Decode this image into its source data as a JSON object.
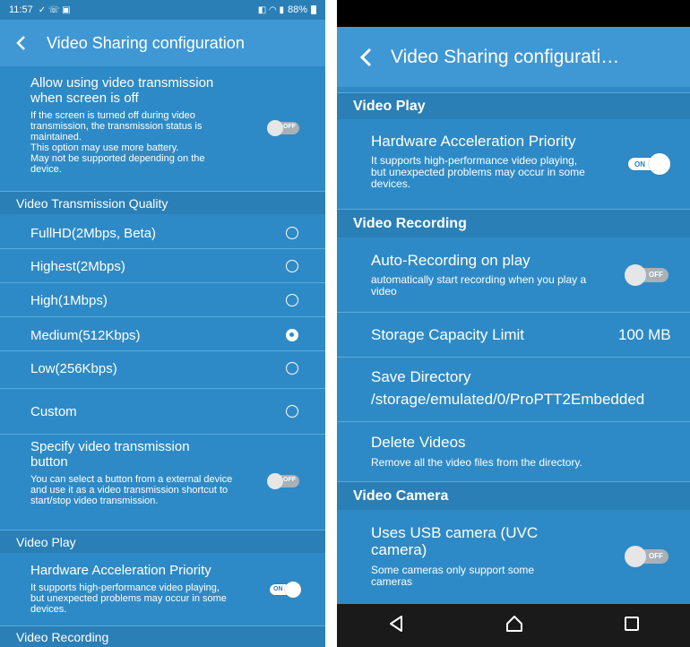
{
  "left": {
    "status": {
      "time": "11:57",
      "battery": "88%"
    },
    "title": "Video Sharing configuration",
    "screen_off": {
      "title": "Allow using video transmission when screen is off",
      "summary": "If the screen is turned off during video transmission, the transmission status is maintained.\nThis option may use more battery.\nMay not be supported depending on the device.",
      "toggle": "OFF"
    },
    "quality_header": "Video Transmission Quality",
    "quality_options": [
      "FullHD(2Mbps, Beta)",
      "Highest(2Mbps)",
      "High(1Mbps)",
      "Medium(512Kbps)",
      "Low(256Kbps)",
      "Custom"
    ],
    "selected_quality": "Medium(512Kbps)",
    "button_setting": {
      "title": "Specify video transmission button",
      "summary": "You can select a button from a external device and use it as a video transmission shortcut to start/stop video transmission.",
      "toggle": "OFF"
    },
    "play_header": "Video Play",
    "hw_accel": {
      "title": "Hardware Acceleration Priority",
      "summary": "It supports high-performance video playing, but unexpected problems may occur in some devices.",
      "toggle": "ON"
    },
    "recording_header": "Video Recording"
  },
  "right": {
    "title": "Video Sharing configurati…",
    "play_header": "Video Play",
    "hw_accel": {
      "title": "Hardware Acceleration Priority",
      "summary": "It supports high-performance video playing, but unexpected problems may occur in some devices.",
      "toggle": "ON"
    },
    "recording_header": "Video Recording",
    "auto_record": {
      "title": "Auto-Recording on play",
      "summary": "automatically start recording when you play a video",
      "toggle": "OFF"
    },
    "storage": {
      "title": "Storage Capacity Limit",
      "value": "100 MB"
    },
    "save_dir": {
      "title": "Save Directory",
      "value": "/storage/emulated/0/ProPTT2Embedded"
    },
    "delete": {
      "title": "Delete Videos",
      "summary": "Remove all the video files from the directory."
    },
    "camera_header": "Video Camera",
    "usb_camera": {
      "title": "Uses USB camera (UVC camera)",
      "summary": "Some cameras only support some cameras",
      "toggle": "OFF"
    }
  },
  "colors": {
    "background": "#2e8ac6",
    "appbar": "#3f98d4",
    "section": "#2a7fb6",
    "nav": "#1a1a1a"
  },
  "icons": [
    "back-arrow-icon",
    "back-triangle-icon",
    "home-circle-icon",
    "recents-square-icon"
  ]
}
